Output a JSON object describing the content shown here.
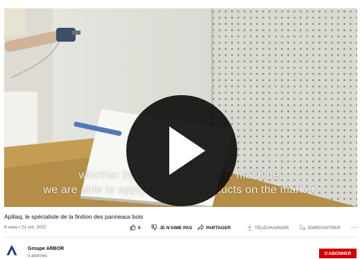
{
  "video": {
    "captions": [
      "whether by spraying, , cylinder machine,",
      "we are able to apply almost ... products on the market."
    ],
    "title": "Aplilaq, le spécialiste de la finition des panneaux bois",
    "meta": "6 vues • 21 oct. 2022"
  },
  "actions": {
    "like_icon": "thumb-up-icon",
    "like_count": "0",
    "dislike_icon": "thumb-down-icon",
    "dislike_label": "JE N'AIME PAS",
    "share_icon": "share-arrow-icon",
    "share_label": "PARTAGER",
    "download_icon": "download-icon",
    "download_label": "TÉLÉCHARGER",
    "save_icon": "playlist-add-icon",
    "save_label": "ENREGISTRER",
    "more_label": "..."
  },
  "channel": {
    "name": "Groupe ARBOR",
    "subscribers": "5 abonnés",
    "subscribe_label": "S'ABONNER"
  },
  "colors": {
    "subscribe": "#cc0000",
    "play_button": "#0a0a0a"
  }
}
